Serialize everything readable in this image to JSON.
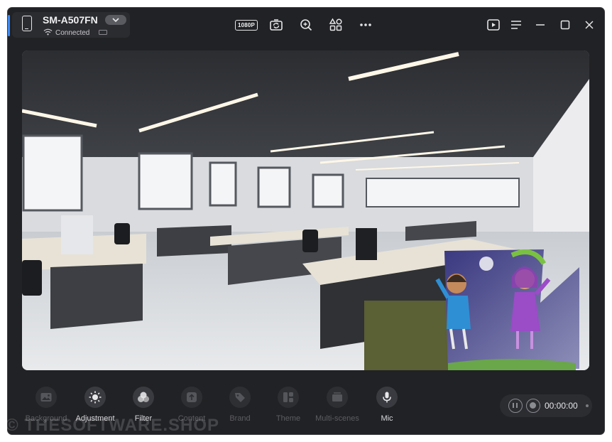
{
  "device": {
    "name": "SM-A507FN",
    "status": "Connected"
  },
  "toolbar": {
    "resolution": "1080P",
    "icons": [
      "phone-icon",
      "wifi-icon",
      "battery-icon",
      "rotate-camera-icon",
      "zoom-in-icon",
      "apps-icon",
      "more-icon",
      "play-icon",
      "menu-icon",
      "minimize-icon",
      "maximize-icon",
      "close-icon"
    ]
  },
  "tools": [
    {
      "label": "Background",
      "icon": "image-icon"
    },
    {
      "label": "Adjustment",
      "icon": "sun-icon"
    },
    {
      "label": "Filter",
      "icon": "filter-icon"
    },
    {
      "label": "Content",
      "icon": "upload-icon"
    },
    {
      "label": "Brand",
      "icon": "tag-icon"
    },
    {
      "label": "Theme",
      "icon": "theme-icon"
    },
    {
      "label": "Multi-scenes",
      "icon": "scenes-icon"
    },
    {
      "label": "Mic",
      "icon": "mic-icon"
    }
  ],
  "recording": {
    "time": "00:00:00"
  },
  "watermark": "© THESOFTWARE.SHOP",
  "colors": {
    "window_bg": "#212225",
    "accent": "#3d8bfd",
    "active_label": "#d8d8dc",
    "muted_label": "#5c5d62"
  }
}
